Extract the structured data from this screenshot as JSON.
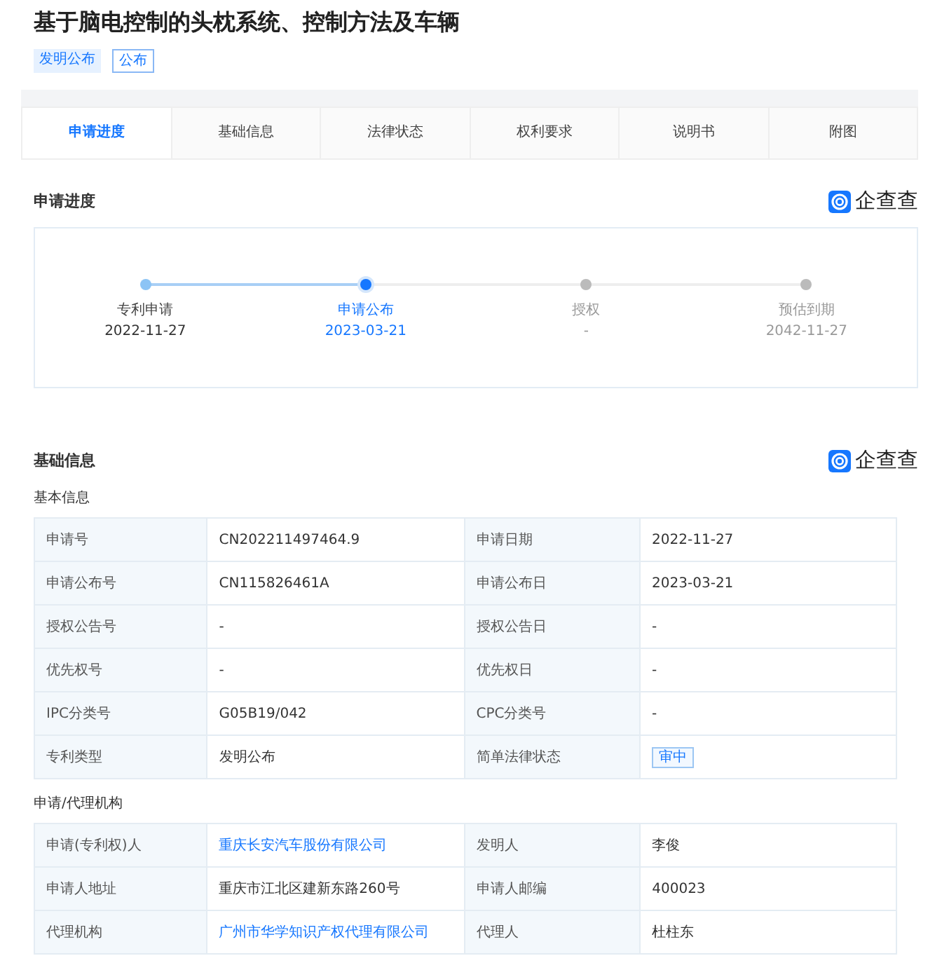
{
  "title": "基于脑电控制的头枕系统、控制方法及车辆",
  "tags": [
    {
      "label": "发明公布",
      "kind": "filled"
    },
    {
      "label": "公布",
      "kind": "outline"
    }
  ],
  "tabs": [
    {
      "label": "申请进度",
      "selected": true
    },
    {
      "label": "基础信息",
      "selected": false
    },
    {
      "label": "法律状态",
      "selected": false
    },
    {
      "label": "权利要求",
      "selected": false
    },
    {
      "label": "说明书",
      "selected": false
    },
    {
      "label": "附图",
      "selected": false
    }
  ],
  "progress": {
    "heading": "申请进度",
    "brand": "企查查",
    "steps": [
      {
        "label": "专利申请",
        "date": "2022-11-27",
        "kind": "done"
      },
      {
        "label": "申请公布",
        "date": "2023-03-21",
        "kind": "current"
      },
      {
        "label": "授权",
        "date": "-",
        "kind": "pending"
      },
      {
        "label": "预估到期",
        "date": "2042-11-27",
        "kind": "pending"
      }
    ]
  },
  "basic": {
    "heading": "基础信息",
    "brand": "企查查",
    "sections": [
      {
        "subheading": "基本信息",
        "rows": [
          [
            {
              "label": "申请号"
            },
            {
              "value": "CN202211497464.9",
              "kind": "text"
            },
            {
              "label": "申请日期"
            },
            {
              "value": "2022-11-27",
              "kind": "text"
            }
          ],
          [
            {
              "label": "申请公布号"
            },
            {
              "value": "CN115826461A",
              "kind": "text"
            },
            {
              "label": "申请公布日"
            },
            {
              "value": "2023-03-21",
              "kind": "text"
            }
          ],
          [
            {
              "label": "授权公告号"
            },
            {
              "value": "-",
              "kind": "text"
            },
            {
              "label": "授权公告日"
            },
            {
              "value": "-",
              "kind": "text"
            }
          ],
          [
            {
              "label": "优先权号"
            },
            {
              "value": "-",
              "kind": "text"
            },
            {
              "label": "优先权日"
            },
            {
              "value": "-",
              "kind": "text"
            }
          ],
          [
            {
              "label": "IPC分类号"
            },
            {
              "value": "G05B19/042",
              "kind": "text"
            },
            {
              "label": "CPC分类号"
            },
            {
              "value": "-",
              "kind": "text"
            }
          ],
          [
            {
              "label": "专利类型"
            },
            {
              "value": "发明公布",
              "kind": "text"
            },
            {
              "label": "简单法律状态"
            },
            {
              "value": "审中",
              "kind": "badge"
            }
          ]
        ]
      },
      {
        "subheading": "申请/代理机构",
        "rows": [
          [
            {
              "label": "申请(专利权)人"
            },
            {
              "value": "重庆长安汽车股份有限公司",
              "kind": "link"
            },
            {
              "label": "发明人"
            },
            {
              "value": "李俊",
              "kind": "text"
            }
          ],
          [
            {
              "label": "申请人地址"
            },
            {
              "value": "重庆市江北区建新东路260号",
              "kind": "text"
            },
            {
              "label": "申请人邮编"
            },
            {
              "value": "400023",
              "kind": "text"
            }
          ],
          [
            {
              "label": "代理机构"
            },
            {
              "value": "广州市华学知识产权代理有限公司",
              "kind": "link"
            },
            {
              "label": "代理人"
            },
            {
              "value": "杜柱东",
              "kind": "text"
            }
          ]
        ]
      }
    ]
  }
}
